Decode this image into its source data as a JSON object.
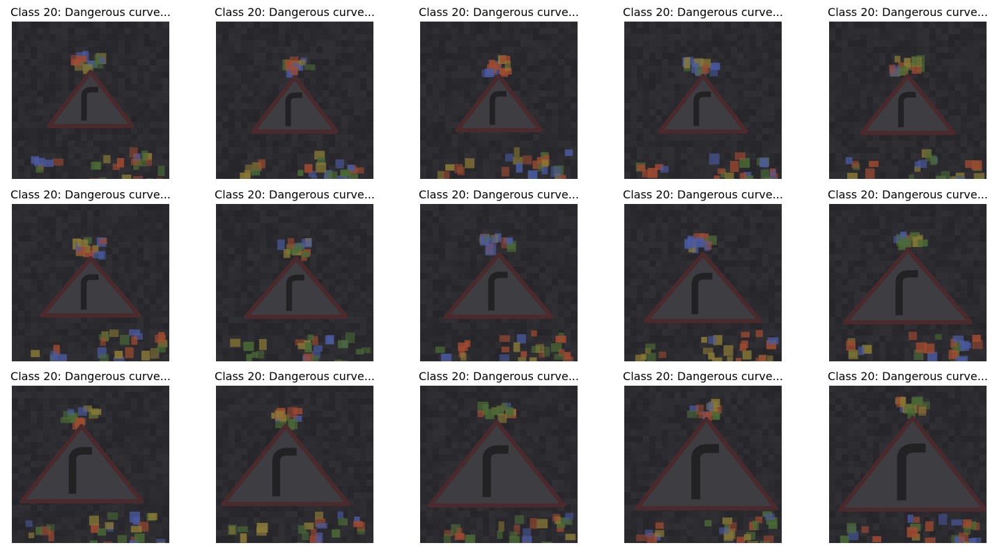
{
  "grid": {
    "rows": 3,
    "columns": 5,
    "titles": [
      [
        "Class 20: Dangerous curve...",
        "Class 20: Dangerous curve...",
        "Class 20: Dangerous curve...",
        "Class 20: Dangerous curve...",
        "Class 20: Dangerous curve..."
      ],
      [
        "Class 20: Dangerous curve...",
        "Class 20: Dangerous curve...",
        "Class 20: Dangerous curve...",
        "Class 20: Dangerous curve...",
        "Class 20: Dangerous curve..."
      ],
      [
        "Class 20: Dangerous curve...",
        "Class 20: Dangerous curve...",
        "Class 20: Dangerous curve...",
        "Class 20: Dangerous curve...",
        "Class 20: Dangerous curve..."
      ]
    ]
  },
  "images": {
    "subject": "dangerous-curve-right-sign-icon",
    "colors": {
      "background": "#2a2a2e",
      "sign_fill": "#3e3e42",
      "sign_border": "#4a2a2c",
      "arrow": "#222225",
      "foliage_yellow": "#8a7a35",
      "foliage_green": "#4a6a35",
      "foliage_red": "#a04a30",
      "foliage_blue": "#4a5aa0"
    }
  }
}
